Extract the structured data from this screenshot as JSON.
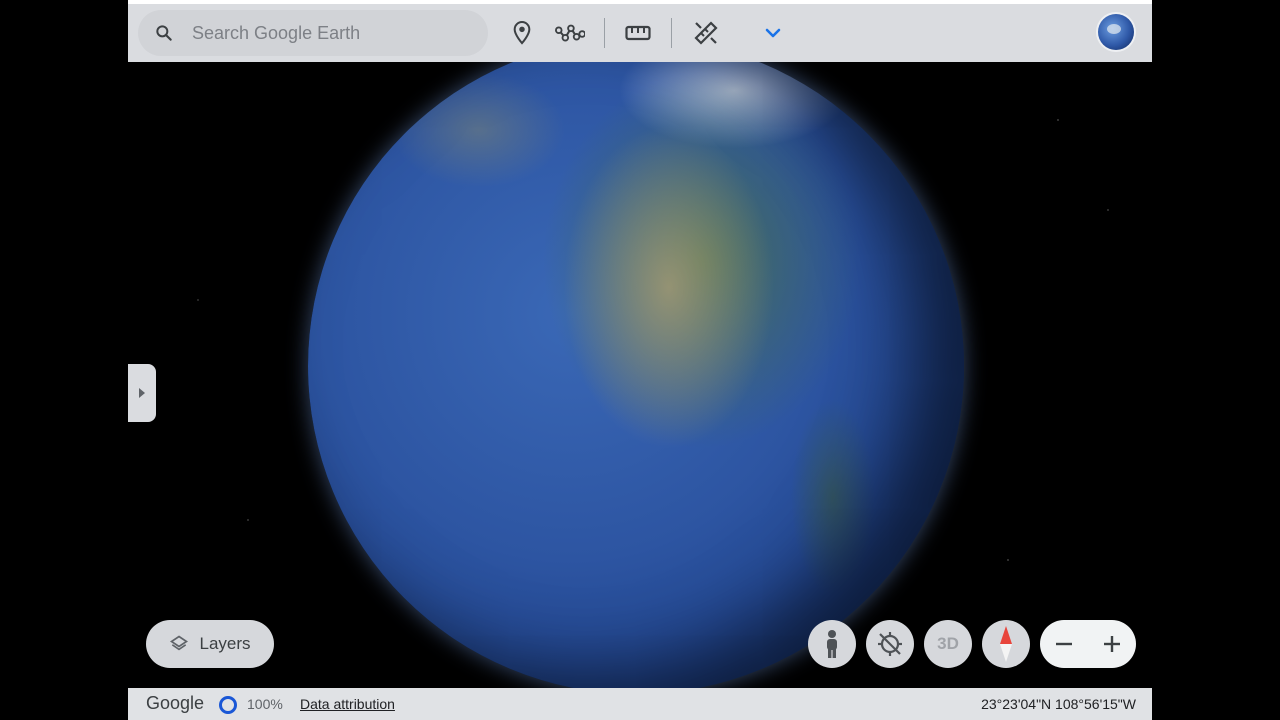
{
  "search": {
    "placeholder": "Search Google Earth"
  },
  "toolbar": {
    "tools": [
      "place-marker-icon",
      "path-icon",
      "ruler-icon",
      "measure-icon",
      "chevron-down-icon"
    ]
  },
  "layers": {
    "label": "Layers"
  },
  "controls": {
    "three_d_label": "3D"
  },
  "bottom": {
    "logo": "Google",
    "load_percent": "100%",
    "attribution": "Data attribution",
    "coordinates": "23°23'04\"N 108°56'15\"W"
  },
  "colors": {
    "accent": "#1a73e8",
    "compass_north": "#e8453c",
    "bar_bg": "#dadce0"
  }
}
